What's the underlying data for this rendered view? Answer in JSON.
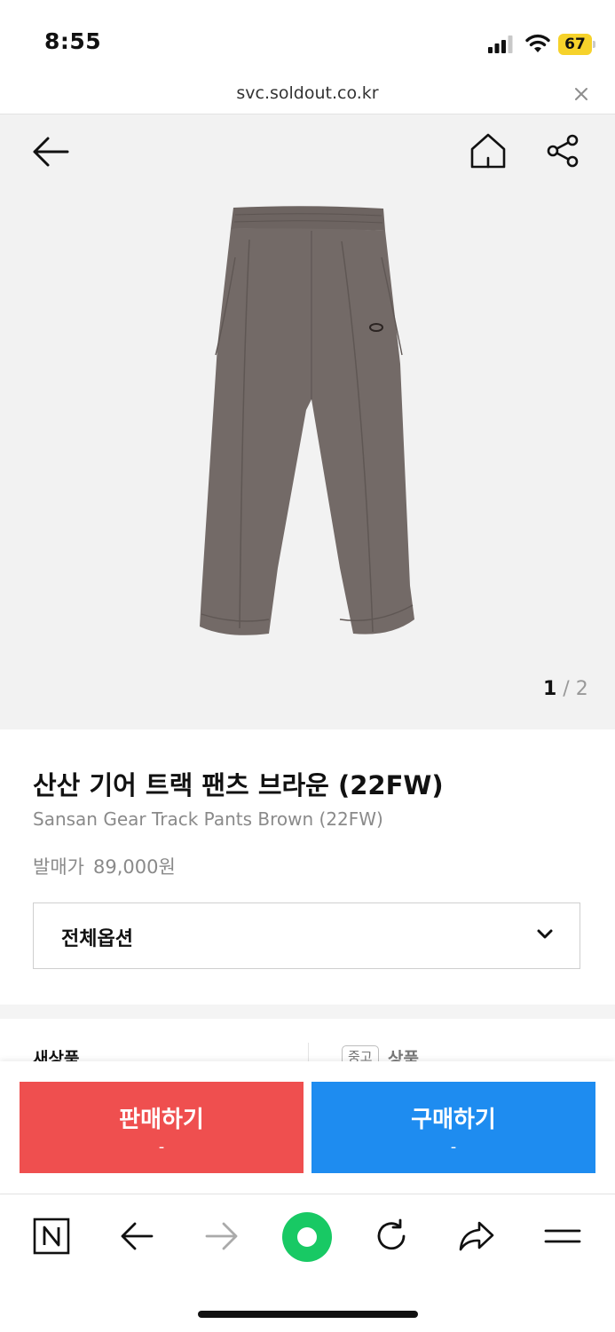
{
  "status_bar": {
    "time": "8:55",
    "battery": "67"
  },
  "url_bar": {
    "url": "svc.soldout.co.kr"
  },
  "product": {
    "image_pager": {
      "current": "1",
      "separator": " / ",
      "total": "2"
    },
    "name_ko": "산산 기어 트랙 팬츠 브라운 (22FW)",
    "name_en": "Sansan Gear Track Pants Brown (22FW)",
    "release_price_label": "발매가",
    "release_price": "89,000원",
    "option_select": {
      "value": "전체옵션"
    }
  },
  "condition_tabs": {
    "new_label": "새상품",
    "used_badge": "중고",
    "used_label": "상품"
  },
  "actions": {
    "sell": {
      "label": "판매하기",
      "sub": "-"
    },
    "buy": {
      "label": "구매하기",
      "sub": "-"
    }
  },
  "colors": {
    "sell": "#ef4f4f",
    "buy": "#1e8cf0",
    "browser_green": "#18c964",
    "battery": "#f6d22b"
  },
  "icons": {
    "header": [
      "back-arrow-icon",
      "home-icon",
      "share-icon"
    ],
    "toolbar": [
      "naver-icon",
      "back-icon",
      "forward-icon",
      "green-dot-icon",
      "reload-icon",
      "share-arrow-icon",
      "menu-icon"
    ]
  }
}
